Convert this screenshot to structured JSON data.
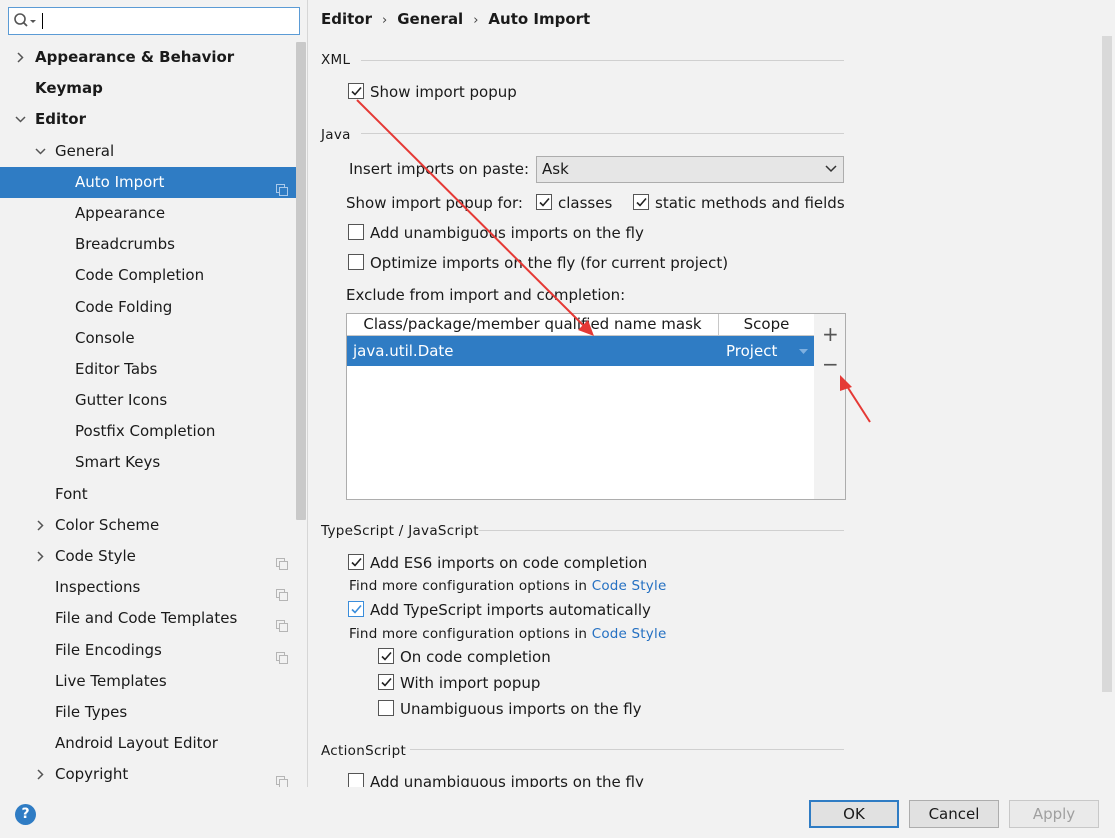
{
  "search": {
    "value": ""
  },
  "breadcrumb": [
    "Editor",
    "General",
    "Auto Import"
  ],
  "tree": [
    {
      "label": "Appearance & Behavior",
      "level": 0,
      "arrow": "right",
      "bold": true,
      "copy": false
    },
    {
      "label": "Keymap",
      "level": 0,
      "arrow": "none",
      "bold": true,
      "copy": false
    },
    {
      "label": "Editor",
      "level": 0,
      "arrow": "down",
      "bold": true,
      "copy": false
    },
    {
      "label": "General",
      "level": 1,
      "arrow": "down",
      "bold": false,
      "copy": false
    },
    {
      "label": "Auto Import",
      "level": 2,
      "arrow": "none",
      "bold": false,
      "copy": true,
      "selected": true
    },
    {
      "label": "Appearance",
      "level": 2,
      "arrow": "none",
      "bold": false,
      "copy": false
    },
    {
      "label": "Breadcrumbs",
      "level": 2,
      "arrow": "none",
      "bold": false,
      "copy": false
    },
    {
      "label": "Code Completion",
      "level": 2,
      "arrow": "none",
      "bold": false,
      "copy": false
    },
    {
      "label": "Code Folding",
      "level": 2,
      "arrow": "none",
      "bold": false,
      "copy": false
    },
    {
      "label": "Console",
      "level": 2,
      "arrow": "none",
      "bold": false,
      "copy": false
    },
    {
      "label": "Editor Tabs",
      "level": 2,
      "arrow": "none",
      "bold": false,
      "copy": false
    },
    {
      "label": "Gutter Icons",
      "level": 2,
      "arrow": "none",
      "bold": false,
      "copy": false
    },
    {
      "label": "Postfix Completion",
      "level": 2,
      "arrow": "none",
      "bold": false,
      "copy": false
    },
    {
      "label": "Smart Keys",
      "level": 2,
      "arrow": "none",
      "bold": false,
      "copy": false
    },
    {
      "label": "Font",
      "level": 1,
      "arrow": "none",
      "bold": false,
      "copy": false
    },
    {
      "label": "Color Scheme",
      "level": 1,
      "arrow": "right",
      "bold": false,
      "copy": false
    },
    {
      "label": "Code Style",
      "level": 1,
      "arrow": "right",
      "bold": false,
      "copy": true
    },
    {
      "label": "Inspections",
      "level": 1,
      "arrow": "none",
      "bold": false,
      "copy": true
    },
    {
      "label": "File and Code Templates",
      "level": 1,
      "arrow": "none",
      "bold": false,
      "copy": true
    },
    {
      "label": "File Encodings",
      "level": 1,
      "arrow": "none",
      "bold": false,
      "copy": true
    },
    {
      "label": "Live Templates",
      "level": 1,
      "arrow": "none",
      "bold": false,
      "copy": false
    },
    {
      "label": "File Types",
      "level": 1,
      "arrow": "none",
      "bold": false,
      "copy": false
    },
    {
      "label": "Android Layout Editor",
      "level": 1,
      "arrow": "none",
      "bold": false,
      "copy": false
    },
    {
      "label": "Copyright",
      "level": 1,
      "arrow": "right",
      "bold": false,
      "copy": true
    }
  ],
  "xml": {
    "title": "XML",
    "show_import_popup": {
      "label": "Show import popup",
      "checked": true
    }
  },
  "java": {
    "title": "Java",
    "paste_label": "Insert imports on paste:",
    "paste_value": "Ask",
    "popup_for_label": "Show import popup for:",
    "classes": {
      "label": "classes",
      "checked": true
    },
    "static": {
      "label": "static methods and fields",
      "checked": true
    },
    "unambiguous": {
      "label": "Add unambiguous imports on the fly",
      "checked": false
    },
    "optimize": {
      "label": "Optimize imports on the fly (for current project)",
      "checked": false
    },
    "exclude_label": "Exclude from import and completion:",
    "table": {
      "col1": "Class/package/member qualified name mask",
      "col2": "Scope",
      "rows": [
        {
          "mask": "java.util.Date",
          "scope": "Project"
        }
      ]
    },
    "add_symbol": "+",
    "remove_symbol": "−"
  },
  "ts": {
    "title": "TypeScript / JavaScript",
    "es6": {
      "label": "Add ES6 imports on code completion",
      "checked": true
    },
    "hint_prefix": "Find more configuration options in",
    "hint_link": "Code Style",
    "ts_auto": {
      "label": "Add TypeScript imports automatically",
      "checked": true
    },
    "on_completion": {
      "label": "On code completion",
      "checked": true
    },
    "with_popup": {
      "label": "With import popup",
      "checked": true
    },
    "unambiguous": {
      "label": "Unambiguous imports on the fly",
      "checked": false
    }
  },
  "actionscript": {
    "title": "ActionScript",
    "unambiguous": {
      "label": "Add unambiguous imports on the fly",
      "checked": false
    }
  },
  "buttons": {
    "help": "?",
    "ok": "OK",
    "cancel": "Cancel",
    "apply": "Apply"
  },
  "colors": {
    "selection": "#2f7cc4",
    "link": "#2470c2",
    "annotation_arrow": "#e53935"
  }
}
